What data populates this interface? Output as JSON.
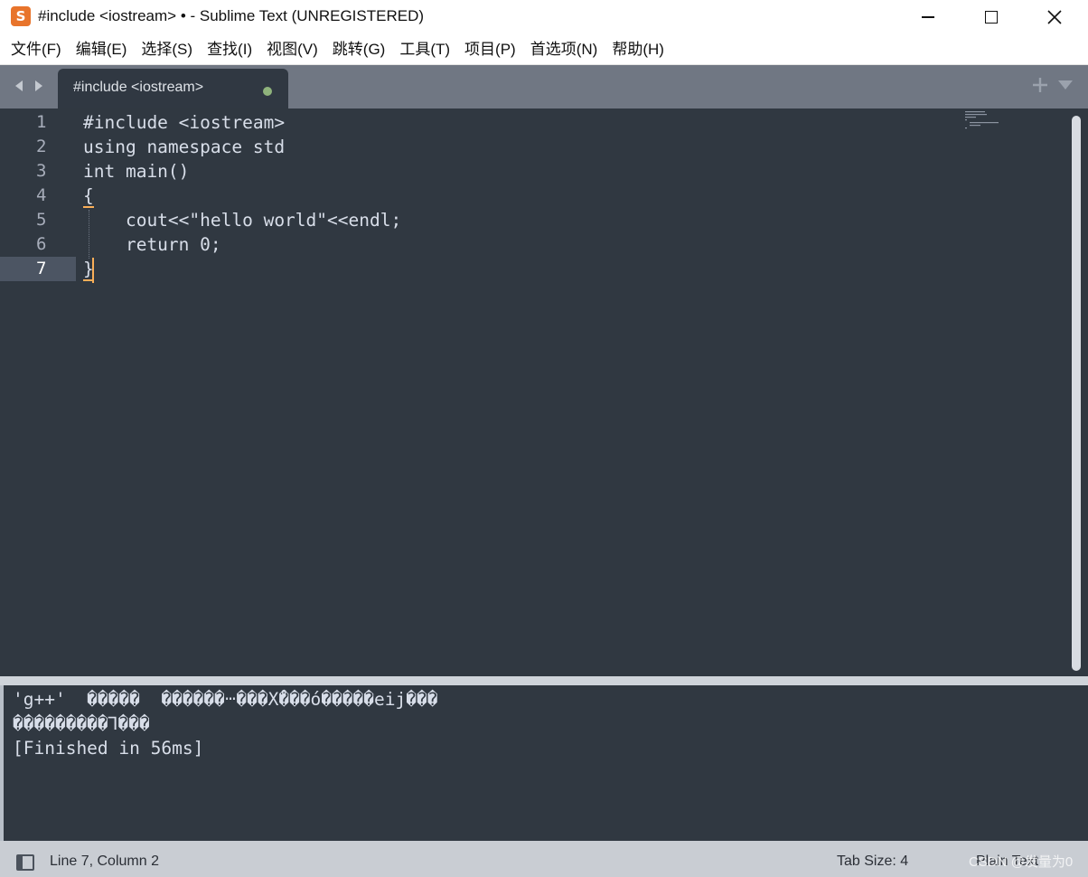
{
  "window": {
    "title": "#include <iostream> • - Sublime Text (UNREGISTERED)",
    "app_icon_glyph": "S"
  },
  "menu": [
    "文件(F)",
    "编辑(E)",
    "选择(S)",
    "查找(I)",
    "视图(V)",
    "跳转(G)",
    "工具(T)",
    "项目(P)",
    "首选项(N)",
    "帮助(H)"
  ],
  "tab": {
    "label": "#include <iostream>",
    "modified": true
  },
  "editor": {
    "line_numbers": [
      "1",
      "2",
      "3",
      "4",
      "5",
      "6",
      "7"
    ],
    "active_line": 7,
    "lines": [
      "#include <iostream>",
      "using namespace std",
      "int main()",
      "{",
      "    cout<<\"hello world\"<<endl;",
      "    return 0;",
      "}"
    ]
  },
  "output": {
    "lines": [
      "'g++'  �����  ������ⵈ���Xْ���ό�����eij���",
      "���������Ꞁ���",
      "[Finished in 56ms]"
    ]
  },
  "status": {
    "position": "Line 7, Column 2",
    "tab_size": "Tab Size: 4",
    "syntax": "Plain Text",
    "watermark": "CSDN @发量为0"
  },
  "colors": {
    "editor_bg": "#303841",
    "accent": "#f9ae58",
    "modified_dot": "#8fb37c"
  }
}
